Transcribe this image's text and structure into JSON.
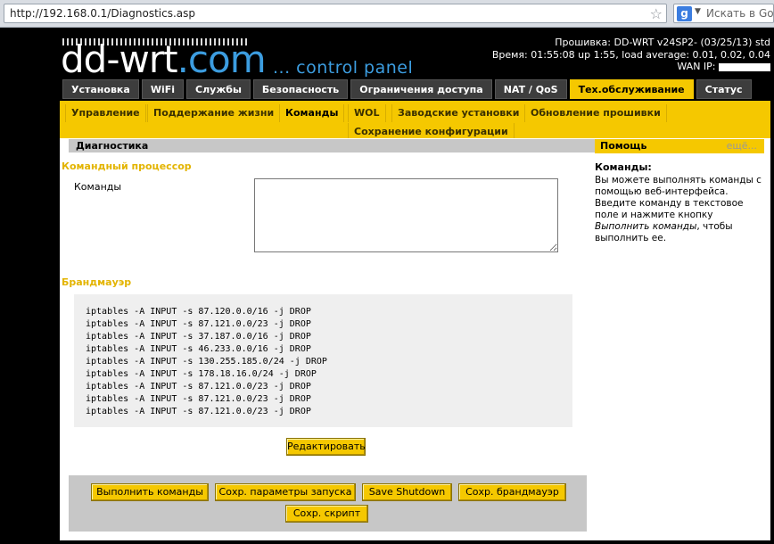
{
  "browser": {
    "url": "http://192.168.0.1/Diagnostics.asp",
    "search_placeholder": "Искать в Goog",
    "search_engine_letter": "g"
  },
  "header": {
    "logo_part1": "dd-wrt",
    "logo_part2": ".com",
    "tagline": "... control panel",
    "firmware": "Прошивка: DD-WRT v24SP2- (03/25/13) std",
    "time": "Время: 01:55:08 up 1:55, load average: 0.01, 0.02, 0.04",
    "wan_ip_label": "WAN IP:"
  },
  "main_tabs": [
    {
      "label": "Установка"
    },
    {
      "label": "WiFi"
    },
    {
      "label": "Службы"
    },
    {
      "label": "Безопасность"
    },
    {
      "label": "Ограничения доступа"
    },
    {
      "label": "NAT / QoS"
    },
    {
      "label": "Тех.обслуживание"
    },
    {
      "label": "Статус"
    }
  ],
  "sub_tabs": [
    {
      "label": "Управление"
    },
    {
      "label": "Поддержание жизни"
    },
    {
      "label": "Команды"
    },
    {
      "label": "WOL"
    },
    {
      "label": "Заводские установки"
    },
    {
      "label": "Обновление прошивки"
    },
    {
      "label": "Сохранение конфигурации"
    }
  ],
  "main": {
    "section_title": "Диагностика",
    "cmd_legend": "Командный процессор",
    "cmd_label": "Команды",
    "cmd_value": "",
    "firewall_legend": "Брандмауэр",
    "firewall_lines": [
      "iptables -A INPUT -s 87.120.0.0/16 -j DROP",
      "iptables -A INPUT -s 87.121.0.0/23 -j DROP",
      "iptables -A INPUT -s 37.187.0.0/16 -j DROP",
      "iptables -A INPUT -s 46.233.0.0/16 -j DROP",
      "iptables -A INPUT -s 130.255.185.0/24 -j DROP",
      "iptables -A INPUT -s 178.18.16.0/24 -j DROP",
      "iptables -A INPUT -s 87.121.0.0/23 -j DROP",
      "iptables -A INPUT -s 87.121.0.0/23 -j DROP",
      "iptables -A INPUT -s 87.121.0.0/23 -j DROP"
    ],
    "edit_button": "Редактировать"
  },
  "footer": {
    "run_button": "Выполнить команды",
    "save_startup_button": "Сохр. параметры запуска",
    "save_shutdown_button": "Save Shutdown",
    "save_firewall_button": "Сохр. брандмауэр",
    "save_script_button": "Сохр. скрипт"
  },
  "help": {
    "header": "Помощь",
    "more": "ещё...",
    "title": "Команды:",
    "text_before": "Вы можете выполнять команды с помощью веб-интерфейса. Введите команду в текстовое поле и нажмите кнопку ",
    "text_italic": "Выполнить команды",
    "text_after": ", чтобы выполнить ее."
  },
  "colors": {
    "accent": "#f5c800",
    "legend": "#e3b400",
    "logo_blue": "#3c9de0"
  }
}
